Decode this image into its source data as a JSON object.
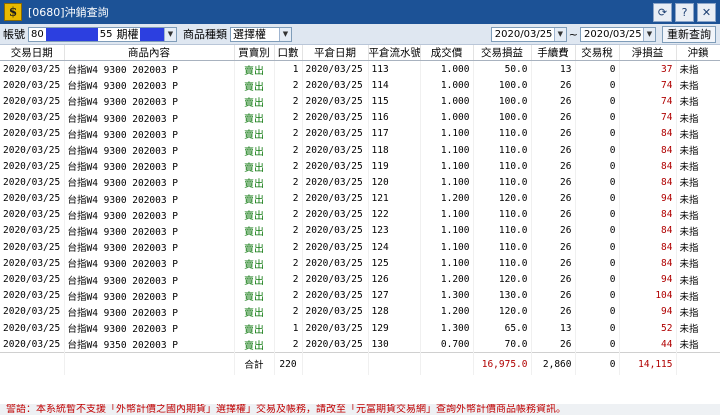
{
  "window": {
    "title": "[0680]沖銷查詢",
    "app_icon": "$",
    "buttons": [
      "refresh-icon",
      "help-icon",
      "close-icon"
    ]
  },
  "toolbar": {
    "account_label": "帳號",
    "account_value": "80",
    "account_suffix": "55",
    "futures_label": "期權",
    "product_type_label": "商品種類",
    "product_type_value": "選擇權",
    "date_from": "2020/03/25",
    "date_separator": "~",
    "date_to": "2020/03/25",
    "requery_label": "重新查詢"
  },
  "table": {
    "columns": [
      "交易日期",
      "商品內容",
      "買賣別",
      "口數",
      "平倉日期",
      "平倉流水號",
      "成交價",
      "交易損益",
      "手續費",
      "交易稅",
      "淨損益",
      "沖鎖"
    ],
    "rows": [
      [
        "2020/03/25",
        "台指W4 9300 202003 P",
        "賣出",
        "1",
        "2020/03/25",
        "113",
        "1.000",
        "50.0",
        "13",
        "0",
        "37",
        "未指"
      ],
      [
        "2020/03/25",
        "台指W4 9300 202003 P",
        "賣出",
        "2",
        "2020/03/25",
        "114",
        "1.000",
        "100.0",
        "26",
        "0",
        "74",
        "未指"
      ],
      [
        "2020/03/25",
        "台指W4 9300 202003 P",
        "賣出",
        "2",
        "2020/03/25",
        "115",
        "1.000",
        "100.0",
        "26",
        "0",
        "74",
        "未指"
      ],
      [
        "2020/03/25",
        "台指W4 9300 202003 P",
        "賣出",
        "2",
        "2020/03/25",
        "116",
        "1.000",
        "100.0",
        "26",
        "0",
        "74",
        "未指"
      ],
      [
        "2020/03/25",
        "台指W4 9300 202003 P",
        "賣出",
        "2",
        "2020/03/25",
        "117",
        "1.100",
        "110.0",
        "26",
        "0",
        "84",
        "未指"
      ],
      [
        "2020/03/25",
        "台指W4 9300 202003 P",
        "賣出",
        "2",
        "2020/03/25",
        "118",
        "1.100",
        "110.0",
        "26",
        "0",
        "84",
        "未指"
      ],
      [
        "2020/03/25",
        "台指W4 9300 202003 P",
        "賣出",
        "2",
        "2020/03/25",
        "119",
        "1.100",
        "110.0",
        "26",
        "0",
        "84",
        "未指"
      ],
      [
        "2020/03/25",
        "台指W4 9300 202003 P",
        "賣出",
        "2",
        "2020/03/25",
        "120",
        "1.100",
        "110.0",
        "26",
        "0",
        "84",
        "未指"
      ],
      [
        "2020/03/25",
        "台指W4 9300 202003 P",
        "賣出",
        "2",
        "2020/03/25",
        "121",
        "1.200",
        "120.0",
        "26",
        "0",
        "94",
        "未指"
      ],
      [
        "2020/03/25",
        "台指W4 9300 202003 P",
        "賣出",
        "2",
        "2020/03/25",
        "122",
        "1.100",
        "110.0",
        "26",
        "0",
        "84",
        "未指"
      ],
      [
        "2020/03/25",
        "台指W4 9300 202003 P",
        "賣出",
        "2",
        "2020/03/25",
        "123",
        "1.100",
        "110.0",
        "26",
        "0",
        "84",
        "未指"
      ],
      [
        "2020/03/25",
        "台指W4 9300 202003 P",
        "賣出",
        "2",
        "2020/03/25",
        "124",
        "1.100",
        "110.0",
        "26",
        "0",
        "84",
        "未指"
      ],
      [
        "2020/03/25",
        "台指W4 9300 202003 P",
        "賣出",
        "2",
        "2020/03/25",
        "125",
        "1.100",
        "110.0",
        "26",
        "0",
        "84",
        "未指"
      ],
      [
        "2020/03/25",
        "台指W4 9300 202003 P",
        "賣出",
        "2",
        "2020/03/25",
        "126",
        "1.200",
        "120.0",
        "26",
        "0",
        "94",
        "未指"
      ],
      [
        "2020/03/25",
        "台指W4 9300 202003 P",
        "賣出",
        "2",
        "2020/03/25",
        "127",
        "1.300",
        "130.0",
        "26",
        "0",
        "104",
        "未指"
      ],
      [
        "2020/03/25",
        "台指W4 9300 202003 P",
        "賣出",
        "2",
        "2020/03/25",
        "128",
        "1.200",
        "120.0",
        "26",
        "0",
        "94",
        "未指"
      ],
      [
        "2020/03/25",
        "台指W4 9300 202003 P",
        "賣出",
        "1",
        "2020/03/25",
        "129",
        "1.300",
        "65.0",
        "13",
        "0",
        "52",
        "未指"
      ],
      [
        "2020/03/25",
        "台指W4 9350 202003 P",
        "賣出",
        "2",
        "2020/03/25",
        "130",
        "0.700",
        "70.0",
        "26",
        "0",
        "44",
        "未指"
      ]
    ],
    "summary": {
      "label": "合計",
      "lots": "220",
      "trade_pnl": "16,975.0",
      "fee": "2,860",
      "tax": "0",
      "net_pnl": "14,115"
    }
  },
  "notice": "警語：本系統暫不支援「外幣計價之國內期貨」選擇權」交易及帳務，請改至「元富期貨交易網」查詢外幣計價商品帳務資訊。",
  "colors": {
    "titlebar": "#1c5296",
    "sell": "#107a10",
    "net_pnl": "#b00000",
    "account_mask": "#2c3fe0"
  }
}
